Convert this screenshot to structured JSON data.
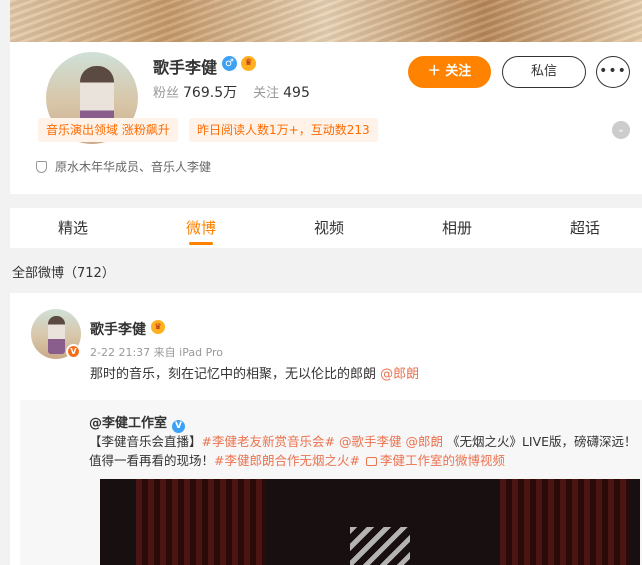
{
  "profile": {
    "name": "歌手李健",
    "gender_icon": "♂",
    "crown_icon": "♛",
    "verified_badge": "V",
    "fans_label": "粉丝",
    "fans_value": "769.5万",
    "following_label": "关注",
    "following_value": "495",
    "follow_button": "＋ 关注",
    "message_button": "私信",
    "more_button": "•••",
    "tags": [
      "音乐演出领域 涨粉飙升",
      "昨日阅读人数1万+，互动数213"
    ],
    "expand_icon": "⌄",
    "intro": "原水木年华成员、音乐人李健"
  },
  "tabs": [
    "精选",
    "微博",
    "视频",
    "相册",
    "超话"
  ],
  "active_tab": "微博",
  "weibo_count": "全部微博（712）",
  "post": {
    "author": "歌手李健",
    "meta": "2-22 21:37  来自 iPad Pro",
    "text": "那时的音乐，刻在记忆中的相聚，无以伦比的郎朗 ",
    "mention": "@郎朗",
    "repost": {
      "author": "@李健工作室",
      "segments": [
        {
          "t": "【李健音乐会直播】",
          "link": false
        },
        {
          "t": "#李健老友新赏音乐会#",
          "link": true
        },
        {
          "t": " ",
          "link": false
        },
        {
          "t": "@歌手李健",
          "link": true
        },
        {
          "t": " ",
          "link": false
        },
        {
          "t": "@郎朗",
          "link": true
        },
        {
          "t": " 《无烟之火》LIVE版，磅礴深远！值得一看再看的现场！",
          "link": false
        },
        {
          "t": "#李健郎朗合作无烟之火#",
          "link": true
        },
        {
          "t": " ",
          "link": false
        },
        {
          "t": "李健工作室的微博视频",
          "link": true,
          "icon": true
        }
      ]
    }
  },
  "colors": {
    "accent": "#ff8200",
    "link": "#eb7350",
    "tag_bg": "#fff3e9",
    "verified": "#f46d19",
    "blue_v": "#3ea1f3"
  }
}
